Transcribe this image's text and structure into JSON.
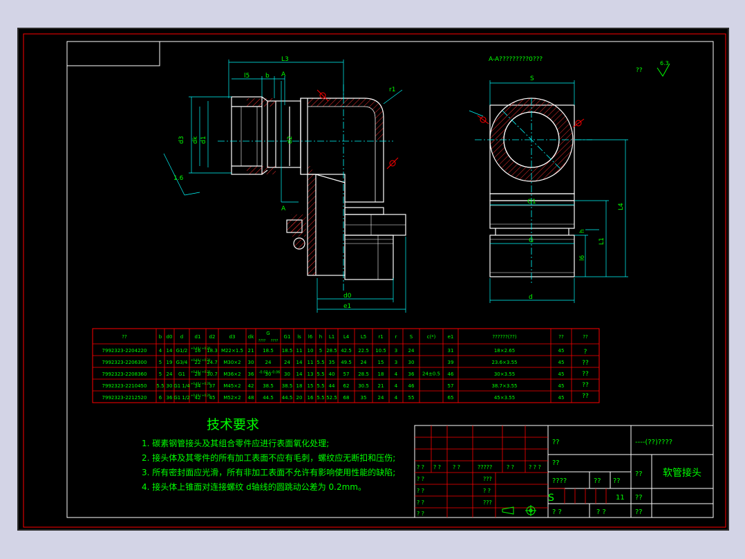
{
  "section_title": "A-A?????????0???",
  "roughness_note": "??",
  "roughness_value": "6.3",
  "table": {
    "headers": [
      "??",
      "b",
      "d0",
      "d",
      "d1",
      "d2",
      "d3",
      "dk",
      "G",
      "G1",
      "ls",
      "l6",
      "h",
      "L1",
      "L4",
      "L5",
      "r1",
      "r",
      "S",
      "c(*)",
      "e1",
      "??????(??)",
      "??",
      "??"
    ],
    "g_subheaders": [
      "????",
      "????"
    ],
    "rows": [
      [
        "7992323-2204220",
        "4",
        "14",
        "G1/2",
        "16",
        "18.3",
        "M22×1.5",
        "21",
        "18.5",
        "18.5",
        "11",
        "10",
        "5",
        "28.5",
        "42.5",
        "22.5",
        "10.5",
        "3",
        "24",
        "31",
        "18×2.65",
        "45"
      ],
      [
        "7992323-2206300",
        "5",
        "19",
        "G3/4",
        "22",
        "24.7",
        "M30×2",
        "30",
        "24",
        "24",
        "14",
        "11",
        "5.5",
        "35",
        "49.5",
        "24",
        "15",
        "3",
        "30",
        "39",
        "23.6×3.55",
        "45"
      ],
      [
        "7992323-2208360",
        "5",
        "24",
        "G1",
        "28",
        "30.7",
        "M36×2",
        "36",
        "30",
        "30",
        "14",
        "13",
        "5.5",
        "40",
        "57",
        "28.5",
        "18",
        "4",
        "36",
        "46",
        "30×3.55",
        "45"
      ],
      [
        "7992323-2210450",
        "5.5",
        "30",
        "G1 1/4",
        "34",
        "37",
        "M45×2",
        "42",
        "38.5",
        "38.5",
        "18",
        "15",
        "5.5",
        "44",
        "62",
        "30.5",
        "21",
        "4",
        "46",
        "57",
        "38.7×3.55",
        "45"
      ],
      [
        "7992323-2212520",
        "6",
        "36",
        "G1 1/2",
        "42",
        "45",
        "M52×2",
        "48",
        "44.5",
        "44.5",
        "20",
        "16",
        "5.5",
        "52.5",
        "68",
        "35",
        "24",
        "4",
        "55",
        "65",
        "45×3.55",
        "45"
      ]
    ],
    "d1_tolerance": "+0.40 / +0.20",
    "g_tolerance": "-0.03 / -0.06",
    "c_value": "24±0.5",
    "remark": [
      "?",
      "??",
      "??",
      "??",
      "??"
    ]
  },
  "tech": {
    "title": "技术要求",
    "items": [
      "1. 碳素钢管接头及其组合零件应进行表面氧化处理;",
      "2. 接头体及其零件的所有加工表面不应有毛刺，螺纹应无断扣和压伤;",
      "3. 所有密封面应光滑，所有非加工表面不允许有影响使用性能的缺陷;",
      "4. 接头体上锥面对连接螺纹 d轴线的圆跳动公差为 0.2mm。"
    ]
  },
  "title_block": {
    "q1": "??",
    "company": "----(??)????",
    "q2": "??",
    "part_name": "软管接头",
    "q3": "??",
    "scale_label": "????",
    "q4": "??",
    "q5": "??",
    "s_mark": "S",
    "sheet_no": "11",
    "q6": "??",
    "q7": "? ?",
    "q8": "? ?",
    "q9": "??",
    "rev_cells": [
      "? ?",
      "? ?",
      "? ?",
      "?????",
      "? ?",
      "? ? ?"
    ],
    "left_cells": [
      "? ?",
      "? ?",
      "???",
      "? ?",
      "? ?",
      "???",
      "? ?"
    ]
  },
  "dims": {
    "L3": "L3",
    "l5": "l5",
    "b": "b",
    "A_top": "A",
    "A_bot": "A",
    "r1": "r1",
    "d3": "d3",
    "dk": "dk",
    "d1": "d1",
    "d2": "d2",
    "d0": "d0",
    "e1": "e1",
    "chamfer": "1.6",
    "S": "S",
    "G1": "G1",
    "G": "G",
    "d": "d",
    "L4": "L4",
    "L1": "L1",
    "l6": "l6",
    "h": "h"
  },
  "colors": {
    "line": "#ffffff",
    "dim": "#00ffff",
    "hatch": "#ff3030",
    "text": "#00ff00",
    "frame": "#ff0000"
  }
}
